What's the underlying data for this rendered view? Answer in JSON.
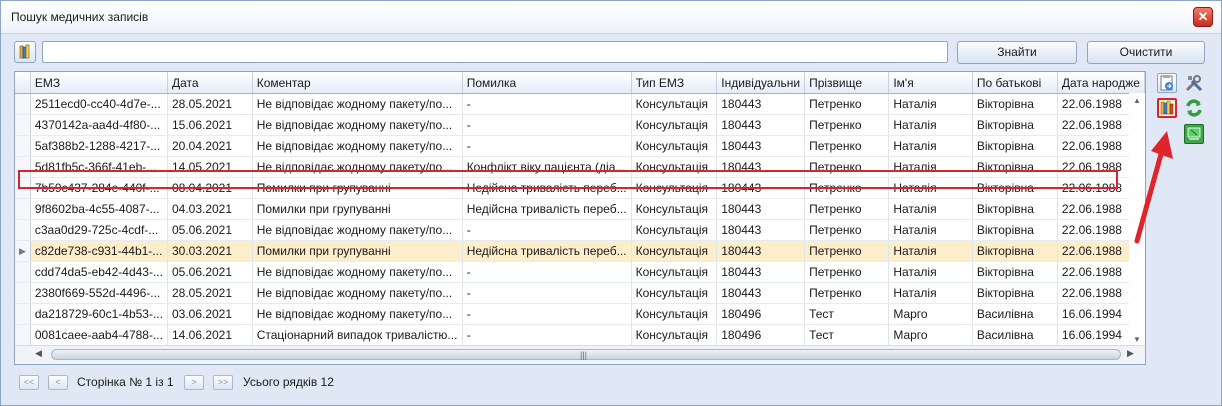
{
  "window": {
    "title": "Пошук медичних записів",
    "close_label": "✕"
  },
  "search": {
    "value": "",
    "placeholder": "",
    "find_label": "Знайти",
    "clear_label": "Очистити"
  },
  "columns": [
    "ЕМЗ",
    "Дата",
    "Коментар",
    "Помилка",
    "Тип ЕМЗ",
    "Індивідуальни",
    "Прізвище",
    "Ім'я",
    "По батькові",
    "Дата народже"
  ],
  "rows": [
    [
      "2511ecd0-cc40-4d7e-...",
      "28.05.2021",
      "Не відповідає жодному пакету/по...",
      "-",
      "Консультація",
      "180443",
      "Петренко",
      "Наталія",
      "Вікторівна",
      "22.06.1988"
    ],
    [
      "4370142a-aa4d-4f80-...",
      "15.06.2021",
      "Не відповідає жодному пакету/по...",
      "-",
      "Консультація",
      "180443",
      "Петренко",
      "Наталія",
      "Вікторівна",
      "22.06.1988"
    ],
    [
      "5af388b2-1288-4217-...",
      "20.04.2021",
      "Не відповідає жодному пакету/по...",
      "-",
      "Консультація",
      "180443",
      "Петренко",
      "Наталія",
      "Вікторівна",
      "22.06.1988"
    ],
    [
      "5d81fb5c-366f-41eb-...",
      "14.05.2021",
      "Не відповідає жодному пакету/по...",
      "Конфлікт віку пацієнта (діа...",
      "Консультація",
      "180443",
      "Петренко",
      "Наталія",
      "Вікторівна",
      "22.06.1988"
    ],
    [
      "7b59c437-284e-440f-...",
      "08.04.2021",
      "Помилки при групуванні",
      "Недійсна тривалість переб...",
      "Консультація",
      "180443",
      "Петренко",
      "Наталія",
      "Вікторівна",
      "22.06.1988"
    ],
    [
      "9f8602ba-4c55-4087-...",
      "04.03.2021",
      "Помилки при групуванні",
      "Недійсна тривалість переб...",
      "Консультація",
      "180443",
      "Петренко",
      "Наталія",
      "Вікторівна",
      "22.06.1988"
    ],
    [
      "c3aa0d29-725c-4cdf-...",
      "05.06.2021",
      "Не відповідає жодному пакету/по...",
      "-",
      "Консультація",
      "180443",
      "Петренко",
      "Наталія",
      "Вікторівна",
      "22.06.1988"
    ],
    [
      "c82de738-c931-44b1-...",
      "30.03.2021",
      "Помилки при групуванні",
      "Недійсна тривалість переб...",
      "Консультація",
      "180443",
      "Петренко",
      "Наталія",
      "Вікторівна",
      "22.06.1988"
    ],
    [
      "cdd74da5-eb42-4d43-...",
      "05.06.2021",
      "Не відповідає жодному пакету/по...",
      "-",
      "Консультація",
      "180443",
      "Петренко",
      "Наталія",
      "Вікторівна",
      "22.06.1988"
    ],
    [
      "2380f669-552d-4496-...",
      "28.05.2021",
      "Не відповідає жодному пакету/по...",
      "-",
      "Консультація",
      "180443",
      "Петренко",
      "Наталія",
      "Вікторівна",
      "22.06.1988"
    ],
    [
      "da218729-60c1-4b53-...",
      "03.06.2021",
      "Не відповідає жодному пакету/по...",
      "-",
      "Консультація",
      "180496",
      "Тест",
      "Марго",
      "Василівна",
      "16.06.1994"
    ],
    [
      "0081caee-aab4-4788-...",
      "14.06.2021",
      "Стаціонарний випадок тривалістю...",
      "-",
      "Консультація",
      "180496",
      "Тест",
      "Марго",
      "Василівна",
      "16.06.1994"
    ]
  ],
  "selected_row": 7,
  "side_icons": [
    "export-doc-icon",
    "tools-icon",
    "document-book-icon",
    "refresh-icon",
    "flag-icon"
  ],
  "pager": {
    "first": "<<",
    "prev": "<",
    "next": ">",
    "last": ">>",
    "page_text": "Сторінка № 1 із 1",
    "rows_text": "Усього рядків 12"
  },
  "colors": {
    "accent_red": "#d9232e",
    "selected_row": "#fdeecb",
    "background": "#dfe8f4"
  }
}
